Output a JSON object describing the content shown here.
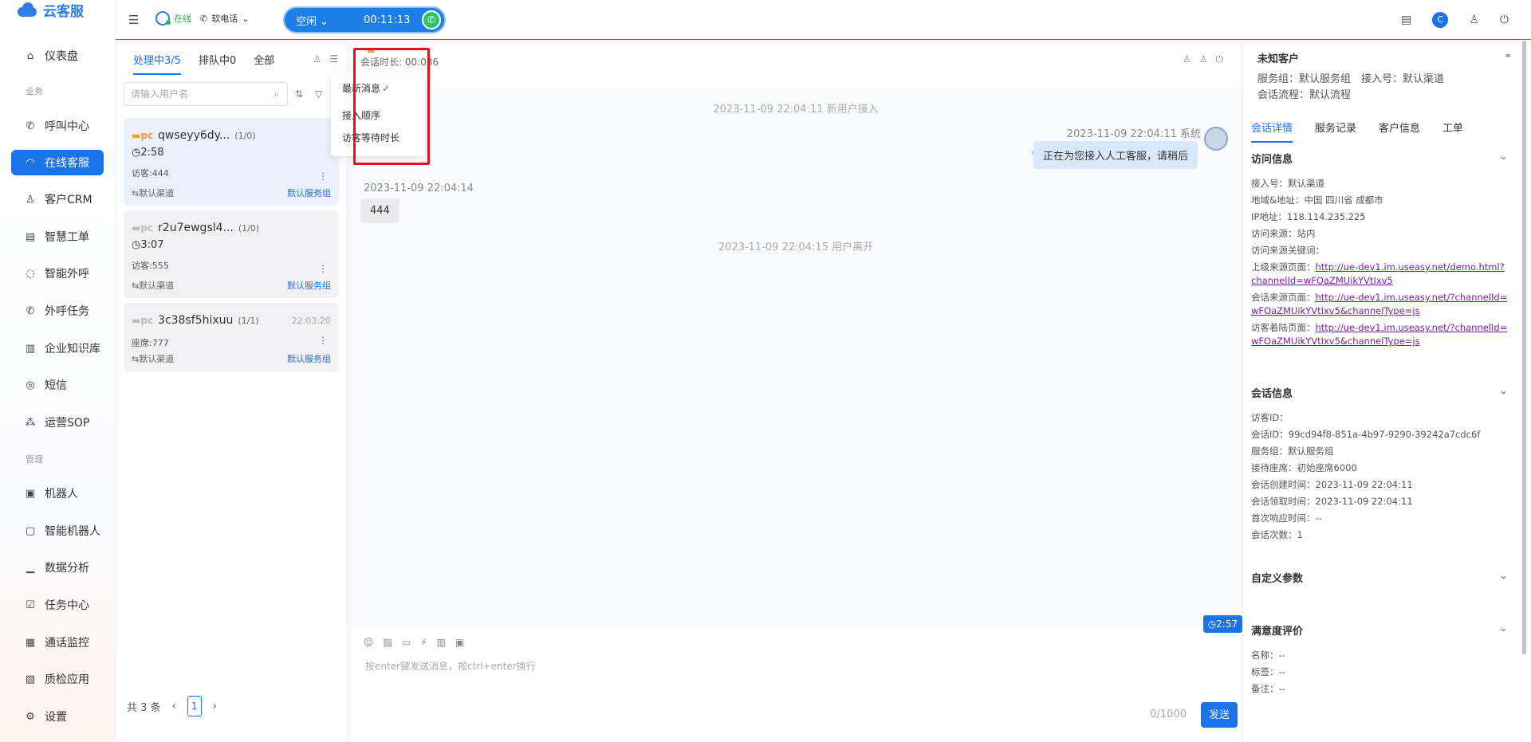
{
  "brand": {
    "name": "云客服",
    "color": "#2f7de8"
  },
  "nav": {
    "items": [
      {
        "label": "仪表盘",
        "icon": "home-icon"
      },
      {
        "label": "呼叫中心",
        "icon": "phone-icon"
      },
      {
        "label": "在线客服",
        "icon": "headset-icon",
        "active": true
      },
      {
        "label": "客户CRM",
        "icon": "user-icon"
      },
      {
        "label": "智慧工单",
        "icon": "ticket-icon"
      },
      {
        "label": "智能外呼",
        "icon": "outbound-call-icon"
      },
      {
        "label": "外呼任务",
        "icon": "call-task-icon"
      },
      {
        "label": "企业知识库",
        "icon": "book-icon"
      },
      {
        "label": "短信",
        "icon": "sms-icon"
      },
      {
        "label": "运营SOP",
        "icon": "flow-icon"
      },
      {
        "label": "机器人",
        "icon": "robot-icon"
      },
      {
        "label": "智能机器人",
        "icon": "smart-robot-icon"
      },
      {
        "label": "数据分析",
        "icon": "chart-icon"
      },
      {
        "label": "任务中心",
        "icon": "task-icon"
      },
      {
        "label": "通话监控",
        "icon": "monitor-icon"
      },
      {
        "label": "质检应用",
        "icon": "quality-icon"
      },
      {
        "label": "设置",
        "icon": "gear-icon"
      }
    ],
    "sections": {
      "business": "业务",
      "manage": "管理"
    }
  },
  "topbar": {
    "online_label": "在线",
    "phone_label": "软电话",
    "call_state": "空闲",
    "call_timer": "00:11:13",
    "avatar_letter": "C"
  },
  "list": {
    "tabs": [
      "处理中3/5",
      "排队中0",
      "全部"
    ],
    "search_placeholder": "请输入用户名",
    "cards": [
      {
        "name": "qwseyy6dy...",
        "count": "(1/0)",
        "time": "",
        "duration": "2:58",
        "visitor": "访客:444",
        "channel": "默认渠道",
        "group": "默认服务组",
        "active": true
      },
      {
        "name": "r2u7ewgsl4...",
        "count": "(1/0)",
        "time": "",
        "duration": "3:07",
        "visitor": "访客:555",
        "channel": "默认渠道",
        "group": "默认服务组",
        "active": false
      },
      {
        "name": "3c38sf5hixuu",
        "count": "(1/1)",
        "time": "22:03:20",
        "duration": "",
        "visitor": "座席:777",
        "channel": "默认渠道",
        "group": "默认服务组",
        "active": false
      }
    ],
    "pager_total": "共 3 条",
    "page": "1"
  },
  "sort_menu": {
    "items": [
      "最新消息",
      "接入顺序",
      "访客等待时长"
    ],
    "selected_mark": "✓"
  },
  "chat": {
    "duration_label": "会话时长: 00:0",
    "duration_tail": "36",
    "sys1": "2023-11-09 22:04:11 新用户接入",
    "agent_time": "2023-11-09 22:04:11 系统",
    "agent_msg": "正在为您接入人工客服，请稍后",
    "visitor_time": "2023-11-09 22:04:14",
    "visitor_msg": "444",
    "sys2": "2023-11-09 22:04:15 用户离开",
    "timer_tag": "2:57",
    "input_placeholder": "按enter键发送消息，按ctrl+enter换行",
    "counter": "0/1000",
    "send": "发送"
  },
  "info": {
    "title": "未知客户",
    "service_group": "服务组：默认服务组",
    "access_no": "接入号：默认渠道",
    "flow": "会话流程：默认流程",
    "tabs": [
      "会话详情",
      "服务记录",
      "客户信息",
      "工单"
    ],
    "visit": {
      "title": "访问信息",
      "access_no": "接入号：默认渠道",
      "region": "地域&地址：中国 四川省 成都市",
      "ip": "IP地址：118.114.235.225",
      "source": "访问来源：站内",
      "keyword": "访问来源关键词：",
      "prev_label": "上级来源页面：",
      "prev_url": "http://ue-dev1.im.useasy.net/demo.html?channelId=wFOaZMUikYVtIxv5",
      "session_label": "会话来源页面：",
      "session_url": "http://ue-dev1.im.useasy.net/?channelId=wFOaZMUikYVtIxv5&channelType=js",
      "landing_label": "访客着陆页面：",
      "landing_url": "http://ue-dev1.im.useasy.net/?channelId=wFOaZMUikYVtIxv5&channelType=js"
    },
    "session": {
      "title": "会话信息",
      "visitor_id": "访客ID：",
      "session_id": "会话ID：99cd94f8-851a-4b97-9290-39242a7cdc6f",
      "group": "服务组：默认服务组",
      "agent": "接待座席：初始座席6000",
      "created": "会话创建时间：2023-11-09 22:04:11",
      "claimed": "会话领取时间：2023-11-09 22:04:11",
      "first_resp": "首次响应时间：--",
      "times": "会话次数：1"
    },
    "custom": {
      "title": "自定义参数"
    },
    "rating": {
      "title": "满意度评价",
      "name": "名称：--",
      "tag": "标签：--",
      "note": "备注：--"
    }
  }
}
